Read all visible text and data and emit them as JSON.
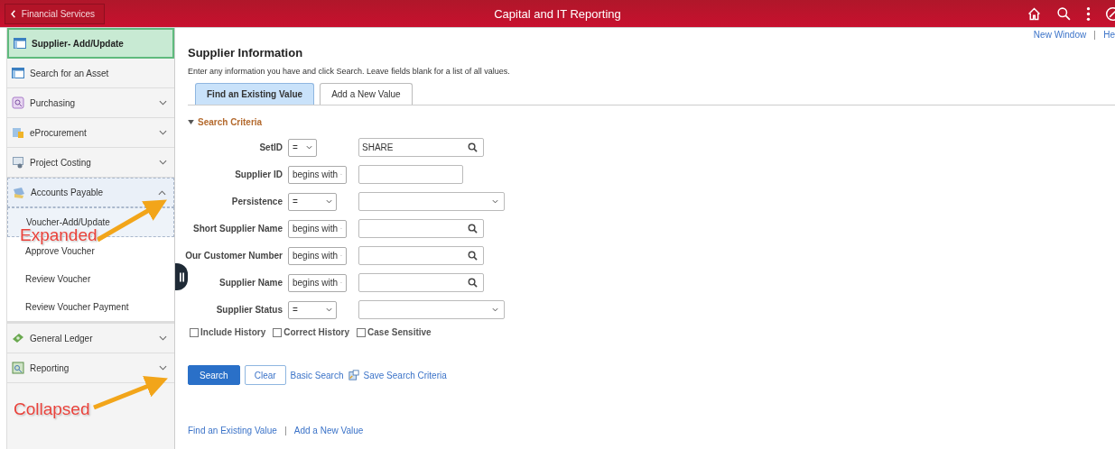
{
  "header": {
    "back_label": "Financial Services",
    "title": "Capital and IT Reporting"
  },
  "top_links": [
    "New Window",
    "He"
  ],
  "sidebar": {
    "items": [
      {
        "label": "Supplier- Add/Update",
        "kind": "link",
        "selected": true
      },
      {
        "label": "Search for an Asset",
        "kind": "link",
        "selected": false
      },
      {
        "label": "Purchasing",
        "kind": "group",
        "selected": false,
        "expanded": false
      },
      {
        "label": "eProcurement",
        "kind": "group",
        "selected": false,
        "expanded": false
      },
      {
        "label": "Project Costing",
        "kind": "group",
        "selected": false,
        "expanded": false
      },
      {
        "label": "Accounts Payable",
        "kind": "group",
        "selected": false,
        "expanded": true,
        "children": [
          {
            "label": "Voucher-Add/Update",
            "selected": true
          },
          {
            "label": "Approve Voucher",
            "selected": false
          },
          {
            "label": "Review Voucher",
            "selected": false
          },
          {
            "label": "Review Voucher Payment",
            "selected": false
          }
        ]
      },
      {
        "label": "General Ledger",
        "kind": "group",
        "selected": false,
        "expanded": false
      },
      {
        "label": "Reporting",
        "kind": "group",
        "selected": false,
        "expanded": false
      }
    ]
  },
  "page": {
    "title": "Supplier Information",
    "instructions": "Enter any information you have and click Search. Leave fields blank for a list of all values.",
    "tabs": [
      {
        "label": "Find an Existing Value",
        "selected": true
      },
      {
        "label": "Add a New Value",
        "selected": false
      }
    ],
    "section": "Search Criteria",
    "criteria": [
      {
        "label": "SetID",
        "operator": "=",
        "kind": "lookup",
        "value": "SHARE"
      },
      {
        "label": "Supplier ID",
        "operator": "begins with",
        "kind": "text"
      },
      {
        "label": "Persistence",
        "operator": "=",
        "kind": "dropdown"
      },
      {
        "label": "Short Supplier Name",
        "operator": "begins with",
        "kind": "lookup"
      },
      {
        "label": "Our Customer Number",
        "operator": "begins with",
        "kind": "lookup"
      },
      {
        "label": "Supplier Name",
        "operator": "begins with",
        "kind": "lookup"
      },
      {
        "label": "Supplier Status",
        "operator": "=",
        "kind": "dropdown"
      }
    ],
    "options": [
      {
        "label": "Include History",
        "checked": false
      },
      {
        "label": "Correct History",
        "checked": false
      },
      {
        "label": "Case Sensitive",
        "checked": false
      }
    ],
    "buttons": {
      "search": "Search",
      "clear": "Clear",
      "basic_search": "Basic Search",
      "save_criteria": "Save Search Criteria"
    },
    "footer_links": [
      "Find an Existing Value",
      "Add a New Value"
    ]
  },
  "annotations": [
    {
      "label": "Expanded"
    },
    {
      "label": "Collapsed"
    }
  ]
}
